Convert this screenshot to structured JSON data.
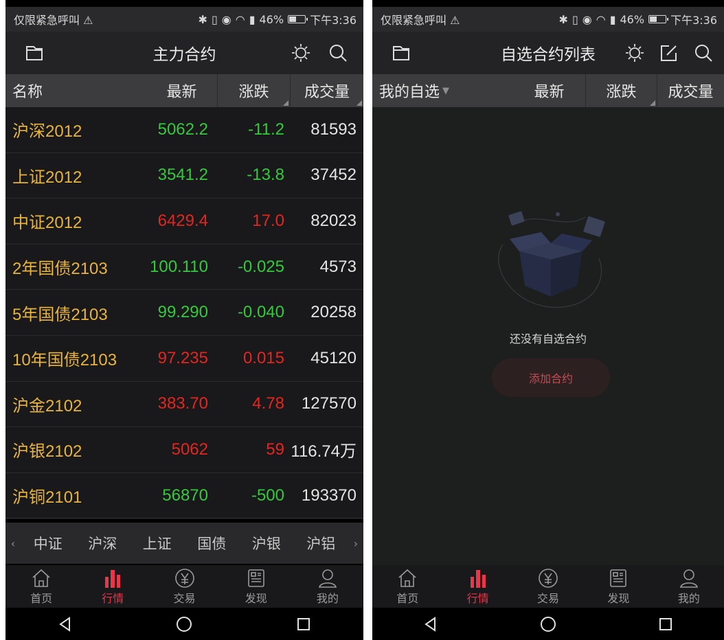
{
  "colors": {
    "up": "#e5251f",
    "down": "#35c93d",
    "name": "#e8b43c",
    "active": "#e8364a"
  },
  "status": {
    "carrier": "仅限紧急呼叫",
    "battery": "46%",
    "battery_level": 0.46,
    "time": "下午3:36"
  },
  "left": {
    "title": "主力合约",
    "columns": {
      "name": "名称",
      "last": "最新",
      "change": "涨跌",
      "volume": "成交量"
    },
    "rows": [
      {
        "name": "沪深2012",
        "last": "5062.2",
        "change": "-11.2",
        "volume": "81593",
        "dir": "down"
      },
      {
        "name": "上证2012",
        "last": "3541.2",
        "change": "-13.8",
        "volume": "37452",
        "dir": "down"
      },
      {
        "name": "中证2012",
        "last": "6429.4",
        "change": "17.0",
        "volume": "82023",
        "dir": "up"
      },
      {
        "name": "2年国债2103",
        "last": "100.110",
        "change": "-0.025",
        "volume": "4573",
        "dir": "down"
      },
      {
        "name": "5年国债2103",
        "last": "99.290",
        "change": "-0.040",
        "volume": "20258",
        "dir": "down"
      },
      {
        "name": "10年国债2103",
        "last": "97.235",
        "change": "0.015",
        "volume": "45120",
        "dir": "up"
      },
      {
        "name": "沪金2102",
        "last": "383.70",
        "change": "4.78",
        "volume": "127570",
        "dir": "up"
      },
      {
        "name": "沪银2102",
        "last": "5062",
        "change": "59",
        "volume": "116.74万",
        "dir": "up"
      },
      {
        "name": "沪铜2101",
        "last": "56870",
        "change": "-500",
        "volume": "193370",
        "dir": "down"
      }
    ],
    "category_tabs": [
      "中证",
      "沪深",
      "上证",
      "国债",
      "沪银",
      "沪铝"
    ]
  },
  "right": {
    "title": "自选合约列表",
    "columns": {
      "name": "我的自选",
      "last": "最新",
      "change": "涨跌",
      "volume": "成交量"
    },
    "empty_message": "还没有自选合约",
    "add_button": "添加合约"
  },
  "nav": [
    {
      "label": "首页",
      "icon": "home-icon"
    },
    {
      "label": "行情",
      "icon": "bar-chart-icon",
      "active": true
    },
    {
      "label": "交易",
      "icon": "yen-icon"
    },
    {
      "label": "发现",
      "icon": "news-icon"
    },
    {
      "label": "我的",
      "icon": "user-icon"
    }
  ]
}
